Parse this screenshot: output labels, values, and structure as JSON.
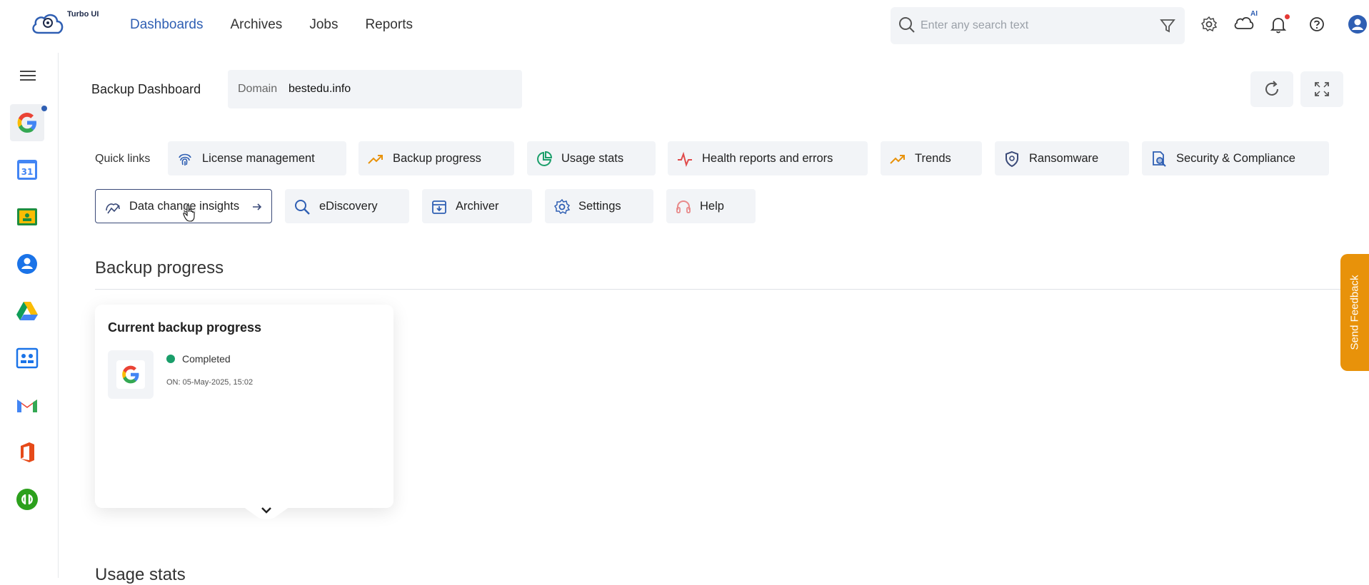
{
  "app": {
    "logo_text": "Turbo UI",
    "ai_badge": "AI"
  },
  "nav": {
    "items": [
      "Dashboards",
      "Archives",
      "Jobs",
      "Reports"
    ],
    "active": "Dashboards"
  },
  "search": {
    "placeholder": "Enter any search text"
  },
  "header": {
    "title": "Backup Dashboard",
    "domain_label": "Domain",
    "domain_value": "bestedu.info"
  },
  "quick_links": {
    "label": "Quick links",
    "row1": [
      "License management",
      "Backup progress",
      "Usage stats",
      "Health reports and errors",
      "Trends",
      "Ransomware",
      "Security & Compliance"
    ],
    "row2": [
      "Data change insights",
      "eDiscovery",
      "Archiver",
      "Settings",
      "Help"
    ]
  },
  "backup_progress": {
    "section_title": "Backup progress",
    "card_title": "Current backup progress",
    "status": "Completed",
    "timestamp": "ON: 05-May-2025, 15:02"
  },
  "usage_stats": {
    "section_title": "Usage stats"
  },
  "feedback": {
    "label": "Send Feedback"
  },
  "colors": {
    "accent": "#2f5fb3",
    "success": "#1a9e6a",
    "feedback": "#e8920a"
  }
}
